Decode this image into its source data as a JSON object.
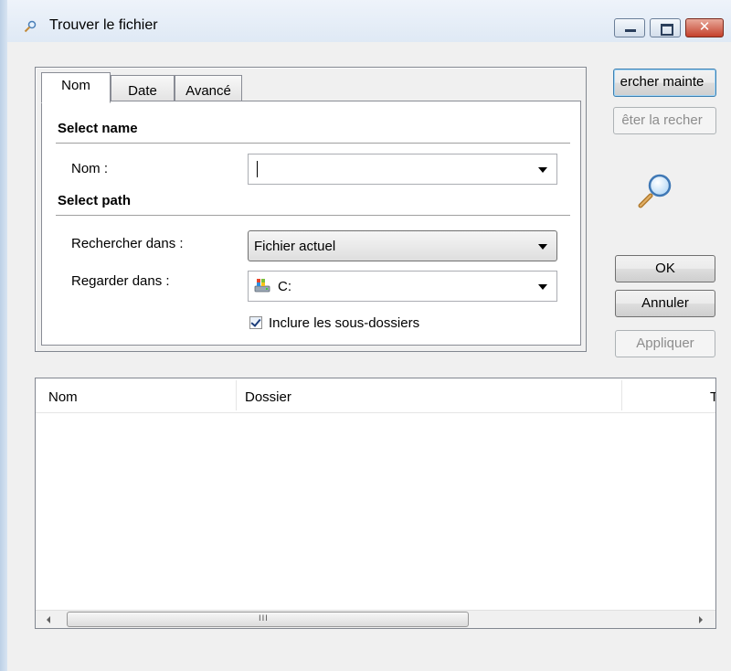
{
  "window": {
    "title": "Trouver le fichier",
    "close_glyph": "✕"
  },
  "tabs": [
    {
      "label": "Nom",
      "active": true
    },
    {
      "label": "Date",
      "active": false
    },
    {
      "label": "Avancé",
      "active": false
    }
  ],
  "name_section": {
    "title": "Select name",
    "nom_label": "Nom :",
    "nom_value": ""
  },
  "path_section": {
    "title": "Select path",
    "search_in_label": "Rechercher dans :",
    "search_in_value": "Fichier actuel",
    "look_in_label": "Regarder dans :",
    "look_in_value": "C:",
    "include_subfolders_label": "Inclure les sous-dossiers",
    "include_subfolders_checked": true
  },
  "buttons": {
    "search_now": "ercher mainte",
    "stop_search": "êter la recher",
    "ok": "OK",
    "cancel": "Annuler",
    "apply": "Appliquer"
  },
  "results": {
    "columns": [
      "Nom",
      "Dossier",
      "T"
    ],
    "rows": [],
    "scroll_grip": "III"
  },
  "colors": {
    "accent_border": "#3c7fb1",
    "disabled_text": "#8d8d8d"
  }
}
